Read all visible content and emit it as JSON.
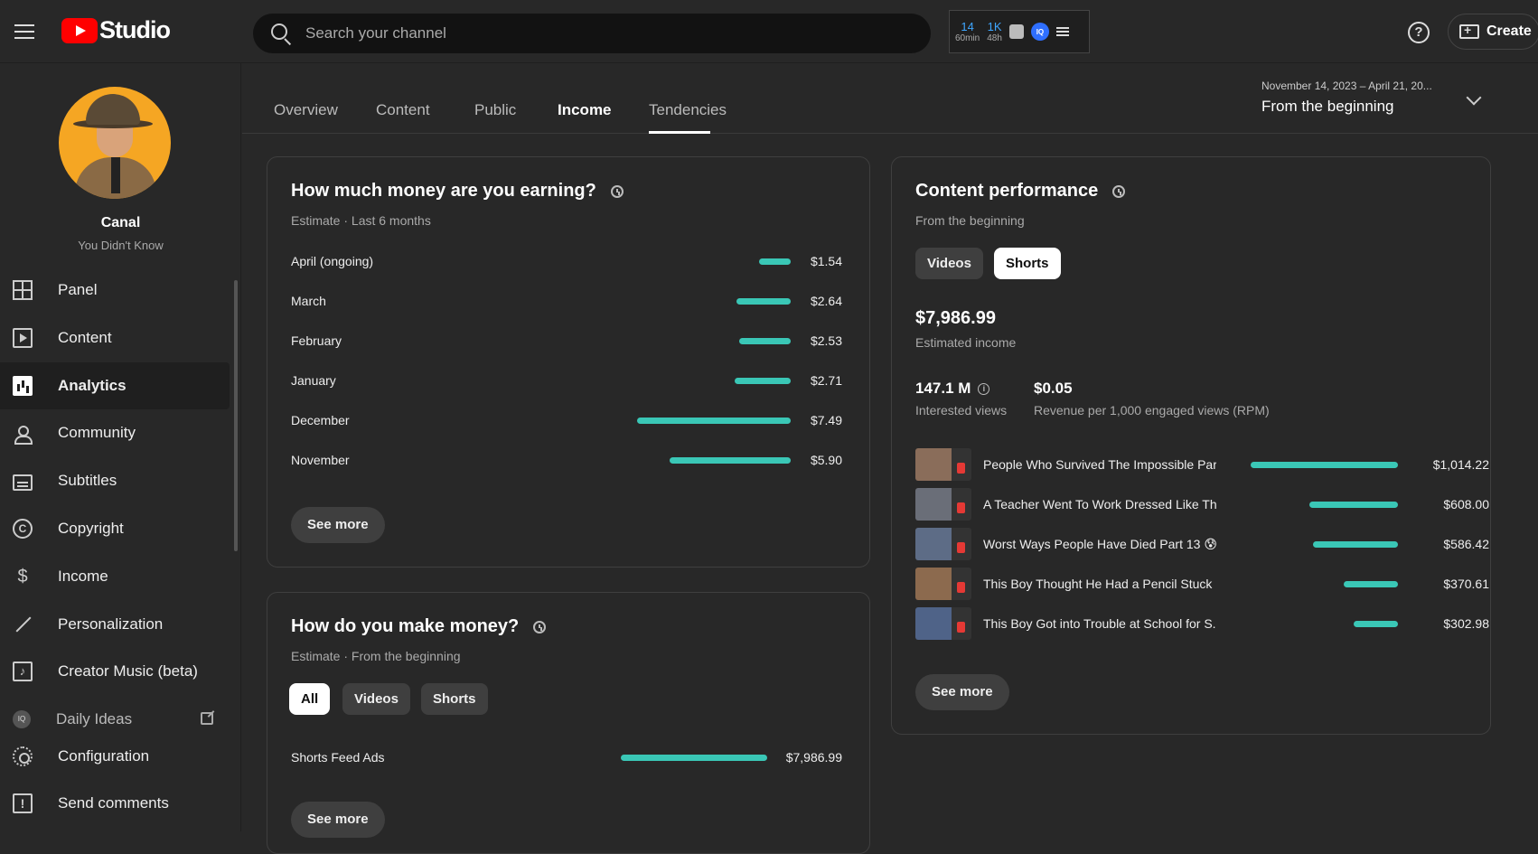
{
  "app": {
    "logo_text": "Studio",
    "brand_color": "#ff0000",
    "accent_color": "#3ac7b6"
  },
  "search": {
    "placeholder": "Search your channel"
  },
  "extension": {
    "stat1_value": "14",
    "stat1_label": "60min",
    "stat2_value": "1K",
    "stat2_label": "48h",
    "badge": "IQ"
  },
  "header": {
    "help_label": "?",
    "create_label": "Create"
  },
  "channel": {
    "name": "Canal",
    "subtitle": "You Didn't Know"
  },
  "sidebar": {
    "items": [
      {
        "label": "Panel",
        "icon": "dashboard-icon"
      },
      {
        "label": "Content",
        "icon": "content-icon"
      },
      {
        "label": "Analytics",
        "icon": "analytics-icon"
      },
      {
        "label": "Community",
        "icon": "community-icon"
      },
      {
        "label": "Subtitles",
        "icon": "subtitles-icon"
      },
      {
        "label": "Copyright",
        "icon": "copyright-icon"
      },
      {
        "label": "Income",
        "icon": "dollar-icon"
      },
      {
        "label": "Personalization",
        "icon": "magic-wand-icon"
      },
      {
        "label": "Creator Music (beta)",
        "icon": "music-icon"
      },
      {
        "label": "Daily Ideas",
        "icon": "ideas-icon"
      },
      {
        "label": "Configuration",
        "icon": "gear-icon"
      },
      {
        "label": "Send comments",
        "icon": "feedback-icon"
      }
    ]
  },
  "tabs": [
    {
      "label": "Overview"
    },
    {
      "label": "Content"
    },
    {
      "label": "Public"
    },
    {
      "label": "Income"
    },
    {
      "label": "Tendencies"
    }
  ],
  "date_range": {
    "range": "November 14, 2023 – April 21, 20...",
    "label": "From the beginning"
  },
  "earning_card": {
    "title": "How much money are you earning?",
    "subtitle": "Estimate · Last 6 months",
    "rows": [
      {
        "label": "April (ongoing)",
        "value": "$1.54",
        "amount": 1.54
      },
      {
        "label": "March",
        "value": "$2.64",
        "amount": 2.64
      },
      {
        "label": "February",
        "value": "$2.53",
        "amount": 2.53
      },
      {
        "label": "January",
        "value": "$2.71",
        "amount": 2.71
      },
      {
        "label": "December",
        "value": "$7.49",
        "amount": 7.49
      },
      {
        "label": "November",
        "value": "$5.90",
        "amount": 5.9
      }
    ],
    "see_more": "See more"
  },
  "make_money_card": {
    "title": "How do you make money?",
    "subtitle": "Estimate · From the beginning",
    "chips": [
      "All",
      "Videos",
      "Shorts"
    ],
    "selected_chip": "All",
    "rows": [
      {
        "label": "Shorts Feed Ads",
        "value": "$7,986.99",
        "amount": 7986.99
      }
    ],
    "see_more": "See more"
  },
  "performance_card": {
    "title": "Content performance",
    "subtitle": "From the beginning",
    "chips": [
      "Videos",
      "Shorts"
    ],
    "selected_chip": "Shorts",
    "income_value": "$7,986.99",
    "income_label": "Estimated income",
    "views_value": "147.1 M",
    "views_label": "Interested views",
    "rpm_value": "$0.05",
    "rpm_label": "Revenue per 1,000 engaged views (RPM)",
    "videos": [
      {
        "title": "People Who Survived The Impossible Par...",
        "value": "$1,014.22",
        "amount": 1014.22
      },
      {
        "title": "A Teacher Went To Work Dressed Like Th...",
        "value": "$608.00",
        "amount": 608.0
      },
      {
        "title": "Worst Ways People Have Died Part 13 😰",
        "value": "$586.42",
        "amount": 586.42
      },
      {
        "title": "This Boy Thought He Had a Pencil Stuck ...",
        "value": "$370.61",
        "amount": 370.61
      },
      {
        "title": "This Boy Got into Trouble at School for S...",
        "value": "$302.98",
        "amount": 302.98
      }
    ],
    "see_more": "See more"
  }
}
